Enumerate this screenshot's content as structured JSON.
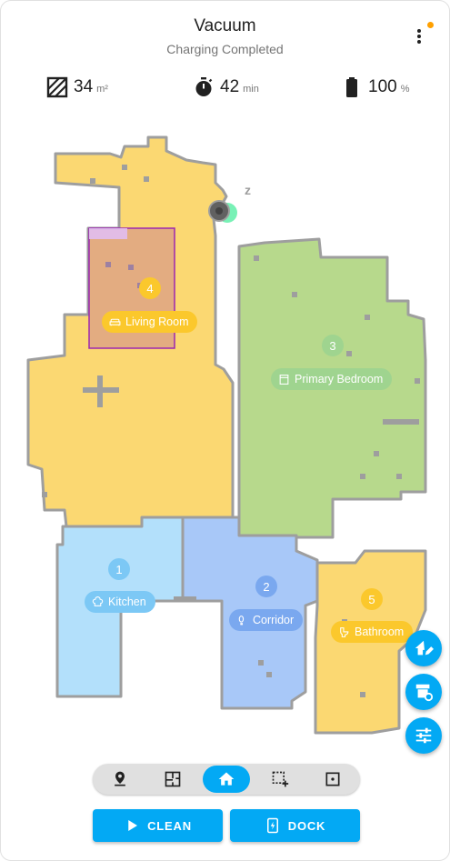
{
  "header": {
    "title": "Vacuum",
    "status": "Charging Completed"
  },
  "stats": {
    "area": {
      "value": "34",
      "unit": "m²",
      "icon": "area-icon"
    },
    "time": {
      "value": "42",
      "unit": "min",
      "icon": "timer-icon"
    },
    "battery": {
      "value": "100",
      "unit": "%",
      "icon": "battery-icon",
      "level": 1.0
    }
  },
  "rooms": [
    {
      "number": "1",
      "name": "Kitchen",
      "icon": "chef-hat-icon",
      "color": "#b3e0fb",
      "label_color": "#7cc8f5"
    },
    {
      "number": "2",
      "name": "Corridor",
      "icon": "shoe-print-icon",
      "color": "#a8c8f8",
      "label_color": "#7aa8ef"
    },
    {
      "number": "3",
      "name": "Primary Bedroom",
      "icon": "wardrobe-icon",
      "color": "#b7d98c",
      "label_color": "#9fd48f"
    },
    {
      "number": "4",
      "name": "Living Room",
      "icon": "sofa-icon",
      "color": "#fbd872",
      "label_color": "#fbc82c"
    },
    {
      "number": "5",
      "name": "Bathroom",
      "icon": "toilet-icon",
      "color": "#fbd872",
      "label_color": "#fbc82c"
    }
  ],
  "map_markers": {
    "charger_label": "z"
  },
  "fabs": [
    "edit-map-icon",
    "room-cleaning-icon",
    "settings-sliders-icon"
  ],
  "mode_tabs": [
    {
      "name": "location",
      "icon": "map-marker-icon",
      "active": false
    },
    {
      "name": "rooms",
      "icon": "floor-plan-icon",
      "active": false
    },
    {
      "name": "all",
      "icon": "home-icon",
      "active": true
    },
    {
      "name": "zone",
      "icon": "select-add-icon",
      "active": false
    },
    {
      "name": "point",
      "icon": "crosshair-icon",
      "active": false
    }
  ],
  "actions": {
    "clean_label": "CLEAN",
    "dock_label": "DOCK"
  },
  "colors": {
    "accent": "#03a9f4",
    "wall": "#9e9e9e",
    "selection": "#9c27b0",
    "status_dot": "#ffa000"
  }
}
